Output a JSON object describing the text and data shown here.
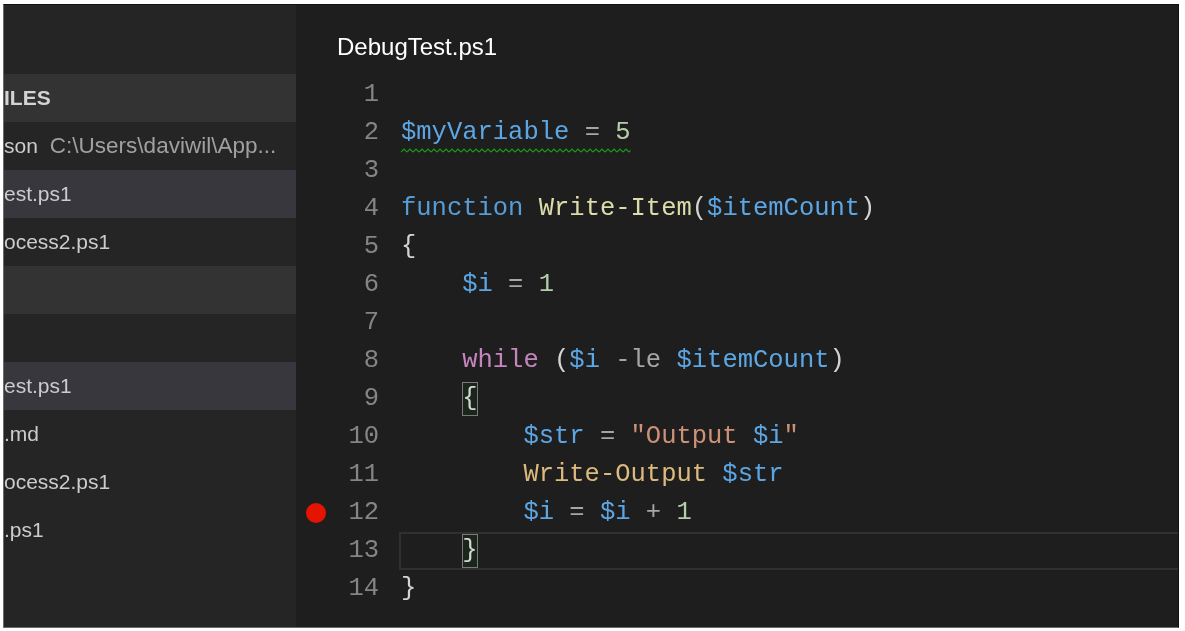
{
  "sidebar": {
    "sections": [
      {
        "header": "ILES",
        "items": [
          {
            "name": "son",
            "path": "C:\\Users\\daviwil\\App...",
            "selected": false
          },
          {
            "name": "est.ps1",
            "selected": true
          },
          {
            "name": "ocess2.ps1",
            "selected": false
          }
        ]
      },
      {
        "items": [
          {
            "name": "est.ps1",
            "selected": true
          },
          {
            "name": ".md",
            "selected": false
          },
          {
            "name": "ocess2.ps1",
            "selected": false
          },
          {
            "name": ".ps1",
            "selected": false
          }
        ]
      }
    ]
  },
  "editor": {
    "tab_title": "DebugTest.ps1",
    "lines": [
      {
        "number": "1",
        "breakpoint": false,
        "current": false,
        "warning": false,
        "bracket_match": false
      },
      {
        "number": "2",
        "breakpoint": false,
        "current": false,
        "warning": true,
        "bracket_match": false,
        "tokens": [
          {
            "kind": "variable",
            "text": "$myVariable"
          },
          {
            "kind": "operator",
            "text": " = "
          },
          {
            "kind": "number",
            "text": "5"
          }
        ]
      },
      {
        "number": "3",
        "breakpoint": false,
        "current": false,
        "warning": false,
        "bracket_match": false
      },
      {
        "number": "4",
        "breakpoint": false,
        "current": false,
        "warning": false,
        "bracket_match": false,
        "tokens": [
          {
            "kind": "keyword",
            "text": "function "
          },
          {
            "kind": "function",
            "text": "Write-Item"
          },
          {
            "kind": "punctuation",
            "text": "("
          },
          {
            "kind": "variable",
            "text": "$itemCount"
          },
          {
            "kind": "punctuation",
            "text": ")"
          }
        ]
      },
      {
        "number": "5",
        "breakpoint": false,
        "current": false,
        "warning": false,
        "bracket_match": false,
        "tokens": [
          {
            "kind": "punctuation",
            "text": "{"
          }
        ],
        "children": [
          {
            "number": "6",
            "breakpoint": false,
            "current": false,
            "warning": false,
            "bracket_match": false,
            "tokens": [
              {
                "kind": "variable",
                "text": "$i"
              },
              {
                "kind": "operator",
                "text": " = "
              },
              {
                "kind": "number",
                "text": "1"
              }
            ]
          },
          {
            "number": "7",
            "breakpoint": false,
            "current": false,
            "warning": false,
            "bracket_match": false
          },
          {
            "number": "8",
            "breakpoint": false,
            "current": false,
            "warning": false,
            "bracket_match": false,
            "tokens": [
              {
                "kind": "control",
                "text": "while "
              },
              {
                "kind": "punctuation",
                "text": "("
              },
              {
                "kind": "variable",
                "text": "$i"
              },
              {
                "kind": "operator",
                "text": " -le "
              },
              {
                "kind": "variable",
                "text": "$itemCount"
              },
              {
                "kind": "punctuation",
                "text": ")"
              }
            ]
          },
          {
            "number": "9",
            "breakpoint": false,
            "current": false,
            "warning": false,
            "bracket_match": true,
            "tokens": [
              {
                "kind": "punctuation",
                "text": "{"
              }
            ],
            "children": [
              {
                "number": "10",
                "breakpoint": false,
                "current": false,
                "warning": false,
                "bracket_match": false,
                "tokens": [
                  {
                    "kind": "variable",
                    "text": "$str"
                  },
                  {
                    "kind": "operator",
                    "text": " = "
                  },
                  {
                    "kind": "string",
                    "text": "\"Output "
                  },
                  {
                    "kind": "variable",
                    "text": "$i"
                  },
                  {
                    "kind": "string",
                    "text": "\""
                  }
                ]
              },
              {
                "number": "11",
                "breakpoint": false,
                "current": false,
                "warning": false,
                "bracket_match": false,
                "tokens": [
                  {
                    "kind": "command",
                    "text": "Write-Output "
                  },
                  {
                    "kind": "variable",
                    "text": "$str"
                  }
                ]
              },
              {
                "number": "12",
                "breakpoint": true,
                "current": false,
                "warning": false,
                "bracket_match": false,
                "tokens": [
                  {
                    "kind": "variable",
                    "text": "$i"
                  },
                  {
                    "kind": "operator",
                    "text": " = "
                  },
                  {
                    "kind": "variable",
                    "text": "$i"
                  },
                  {
                    "kind": "operator",
                    "text": " + "
                  },
                  {
                    "kind": "number",
                    "text": "1"
                  }
                ]
              }
            ]
          },
          {
            "number": "13",
            "breakpoint": false,
            "current": true,
            "warning": false,
            "bracket_match": true,
            "tokens": [
              {
                "kind": "punctuation",
                "text": "}"
              }
            ]
          }
        ]
      },
      {
        "number": "14",
        "breakpoint": false,
        "current": false,
        "warning": false,
        "bracket_match": false,
        "tokens": [
          {
            "kind": "punctuation",
            "text": "}"
          }
        ]
      }
    ]
  }
}
